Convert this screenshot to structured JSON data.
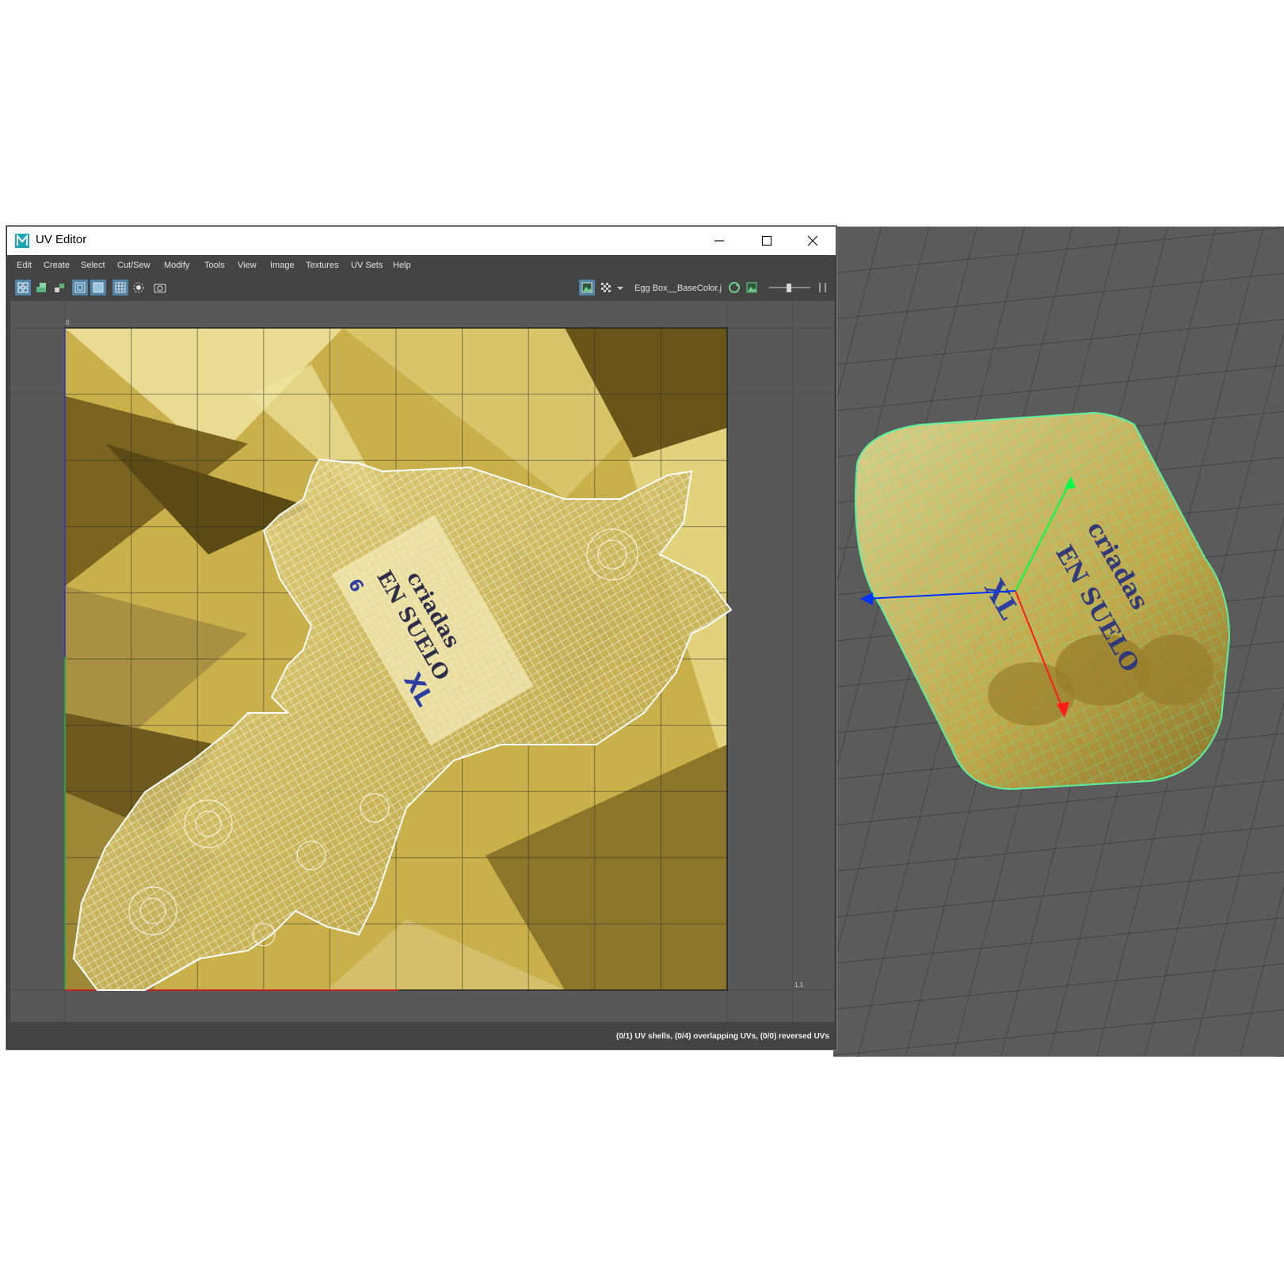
{
  "window": {
    "title": "UV Editor",
    "minimize_glyph": "—",
    "maximize_glyph": "☐",
    "close_glyph": "✕"
  },
  "menu": [
    "Edit",
    "Create",
    "Select",
    "Cut/Sew",
    "Modify",
    "Tools",
    "View",
    "Image",
    "Textures",
    "UV Sets",
    "Help"
  ],
  "toolbar": {
    "texture_name": "Egg Box__BaseColor.j",
    "icons": [
      "uv-shell-icon",
      "uv-snapshot-icon",
      "uv-layout-icon",
      "wireframe-icon",
      "shaded-icon",
      "grid-icon",
      "isolate-icon",
      "camera-icon",
      "image-display-icon",
      "checker-icon",
      "dropdown-arrow-icon",
      "refresh-texture-icon",
      "image-icon",
      "exposure-slider",
      "more-icon"
    ]
  },
  "uv_grid": {
    "corner_labels": {
      "origin": "0",
      "top_right": "1,1"
    }
  },
  "status_text": "(0/1) UV shells, (0/4) overlapping UVs, (0/0) reversed UVs",
  "texture_labels": [
    "criadas",
    "EN SUELO",
    "XL",
    "6"
  ],
  "colors": {
    "texture_gold": "#c9b04a",
    "wire": "#ffffff",
    "viewport_bg": "#5b5b5b",
    "selection_green": "#5af0a0",
    "accent_blue": "#5285a6"
  }
}
